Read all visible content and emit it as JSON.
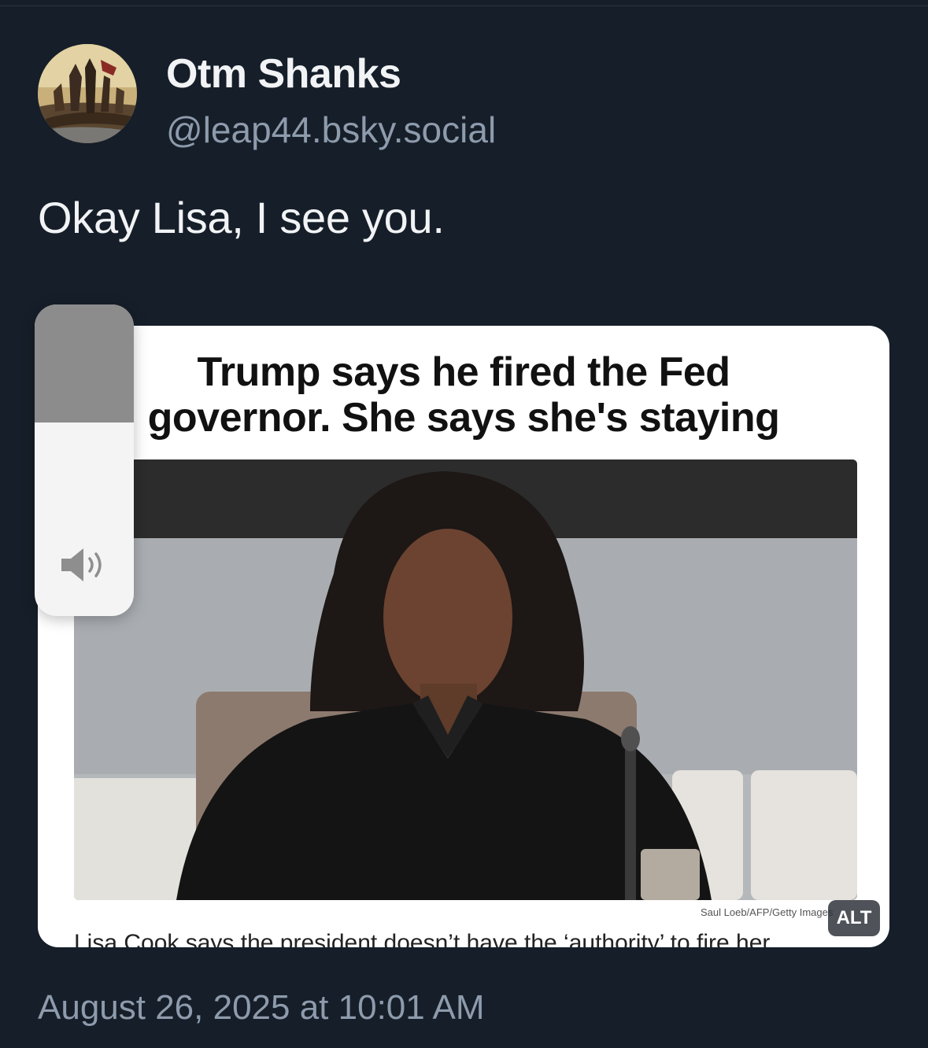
{
  "post": {
    "author_name": "Otm Shanks",
    "author_handle": "@leap44.bsky.social",
    "text": "Okay Lisa, I see you.",
    "timestamp": "August 26, 2025 at 10:01 AM"
  },
  "embed": {
    "headline_line1": "Trump says he fired the Fed",
    "headline_line2": "governor. She says she's staying",
    "photo_credit": "Saul Loeb/AFP/Getty Images",
    "caption": "Lisa Cook says the president doesn’t have the ‘authority’ to fire her",
    "alt_label": "ALT"
  },
  "volume_hud": {
    "level": 0.62,
    "icon": "speaker-icon"
  },
  "colors": {
    "background": "#161e29",
    "primary_text": "#f1f3f5",
    "secondary_text": "#8d9bac"
  }
}
